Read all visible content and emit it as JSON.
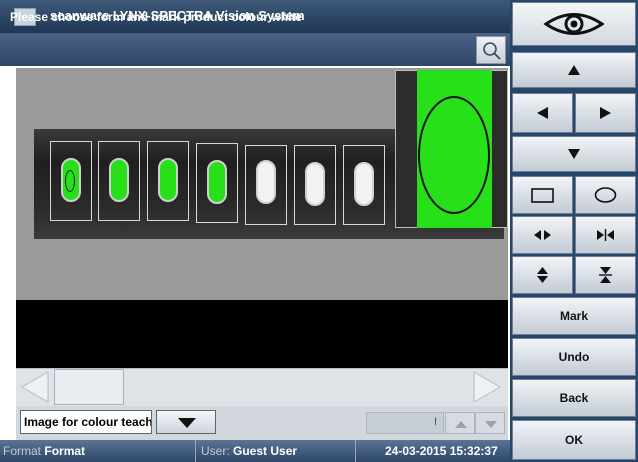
{
  "window": {
    "title": "scanware LYNX-SPECTRA Vision System"
  },
  "instruction": {
    "text": "Please choose form and mark product colour white"
  },
  "icons": {
    "zoom": "magnifier-icon",
    "eye": "eye-icon",
    "up": "arrow-up-icon",
    "down": "arrow-down-icon",
    "left": "arrow-left-icon",
    "right": "arrow-right-icon",
    "rectangle": "rectangle-shape-icon",
    "ellipse": "ellipse-shape-icon",
    "widen": "expand-horizontal-icon",
    "narrow": "shrink-horizontal-icon",
    "taller": "expand-vertical-icon",
    "shorter": "shrink-vertical-icon"
  },
  "controls": {
    "image_select_value": "Image for colour teachi",
    "number_field_value": "I"
  },
  "status": {
    "format_label": "Format",
    "format_value": "Format",
    "user_label": "User:",
    "user_value": "Guest User",
    "datetime": "24-03-2015 15:32:37"
  },
  "right_panel": {
    "mark_label": "Mark",
    "undo_label": "Undo",
    "back_label": "Back",
    "ok_label": "OK"
  },
  "colors": {
    "titlebar": "#1f3553",
    "panel": "#26466c",
    "mark_green": "#27e01a"
  }
}
